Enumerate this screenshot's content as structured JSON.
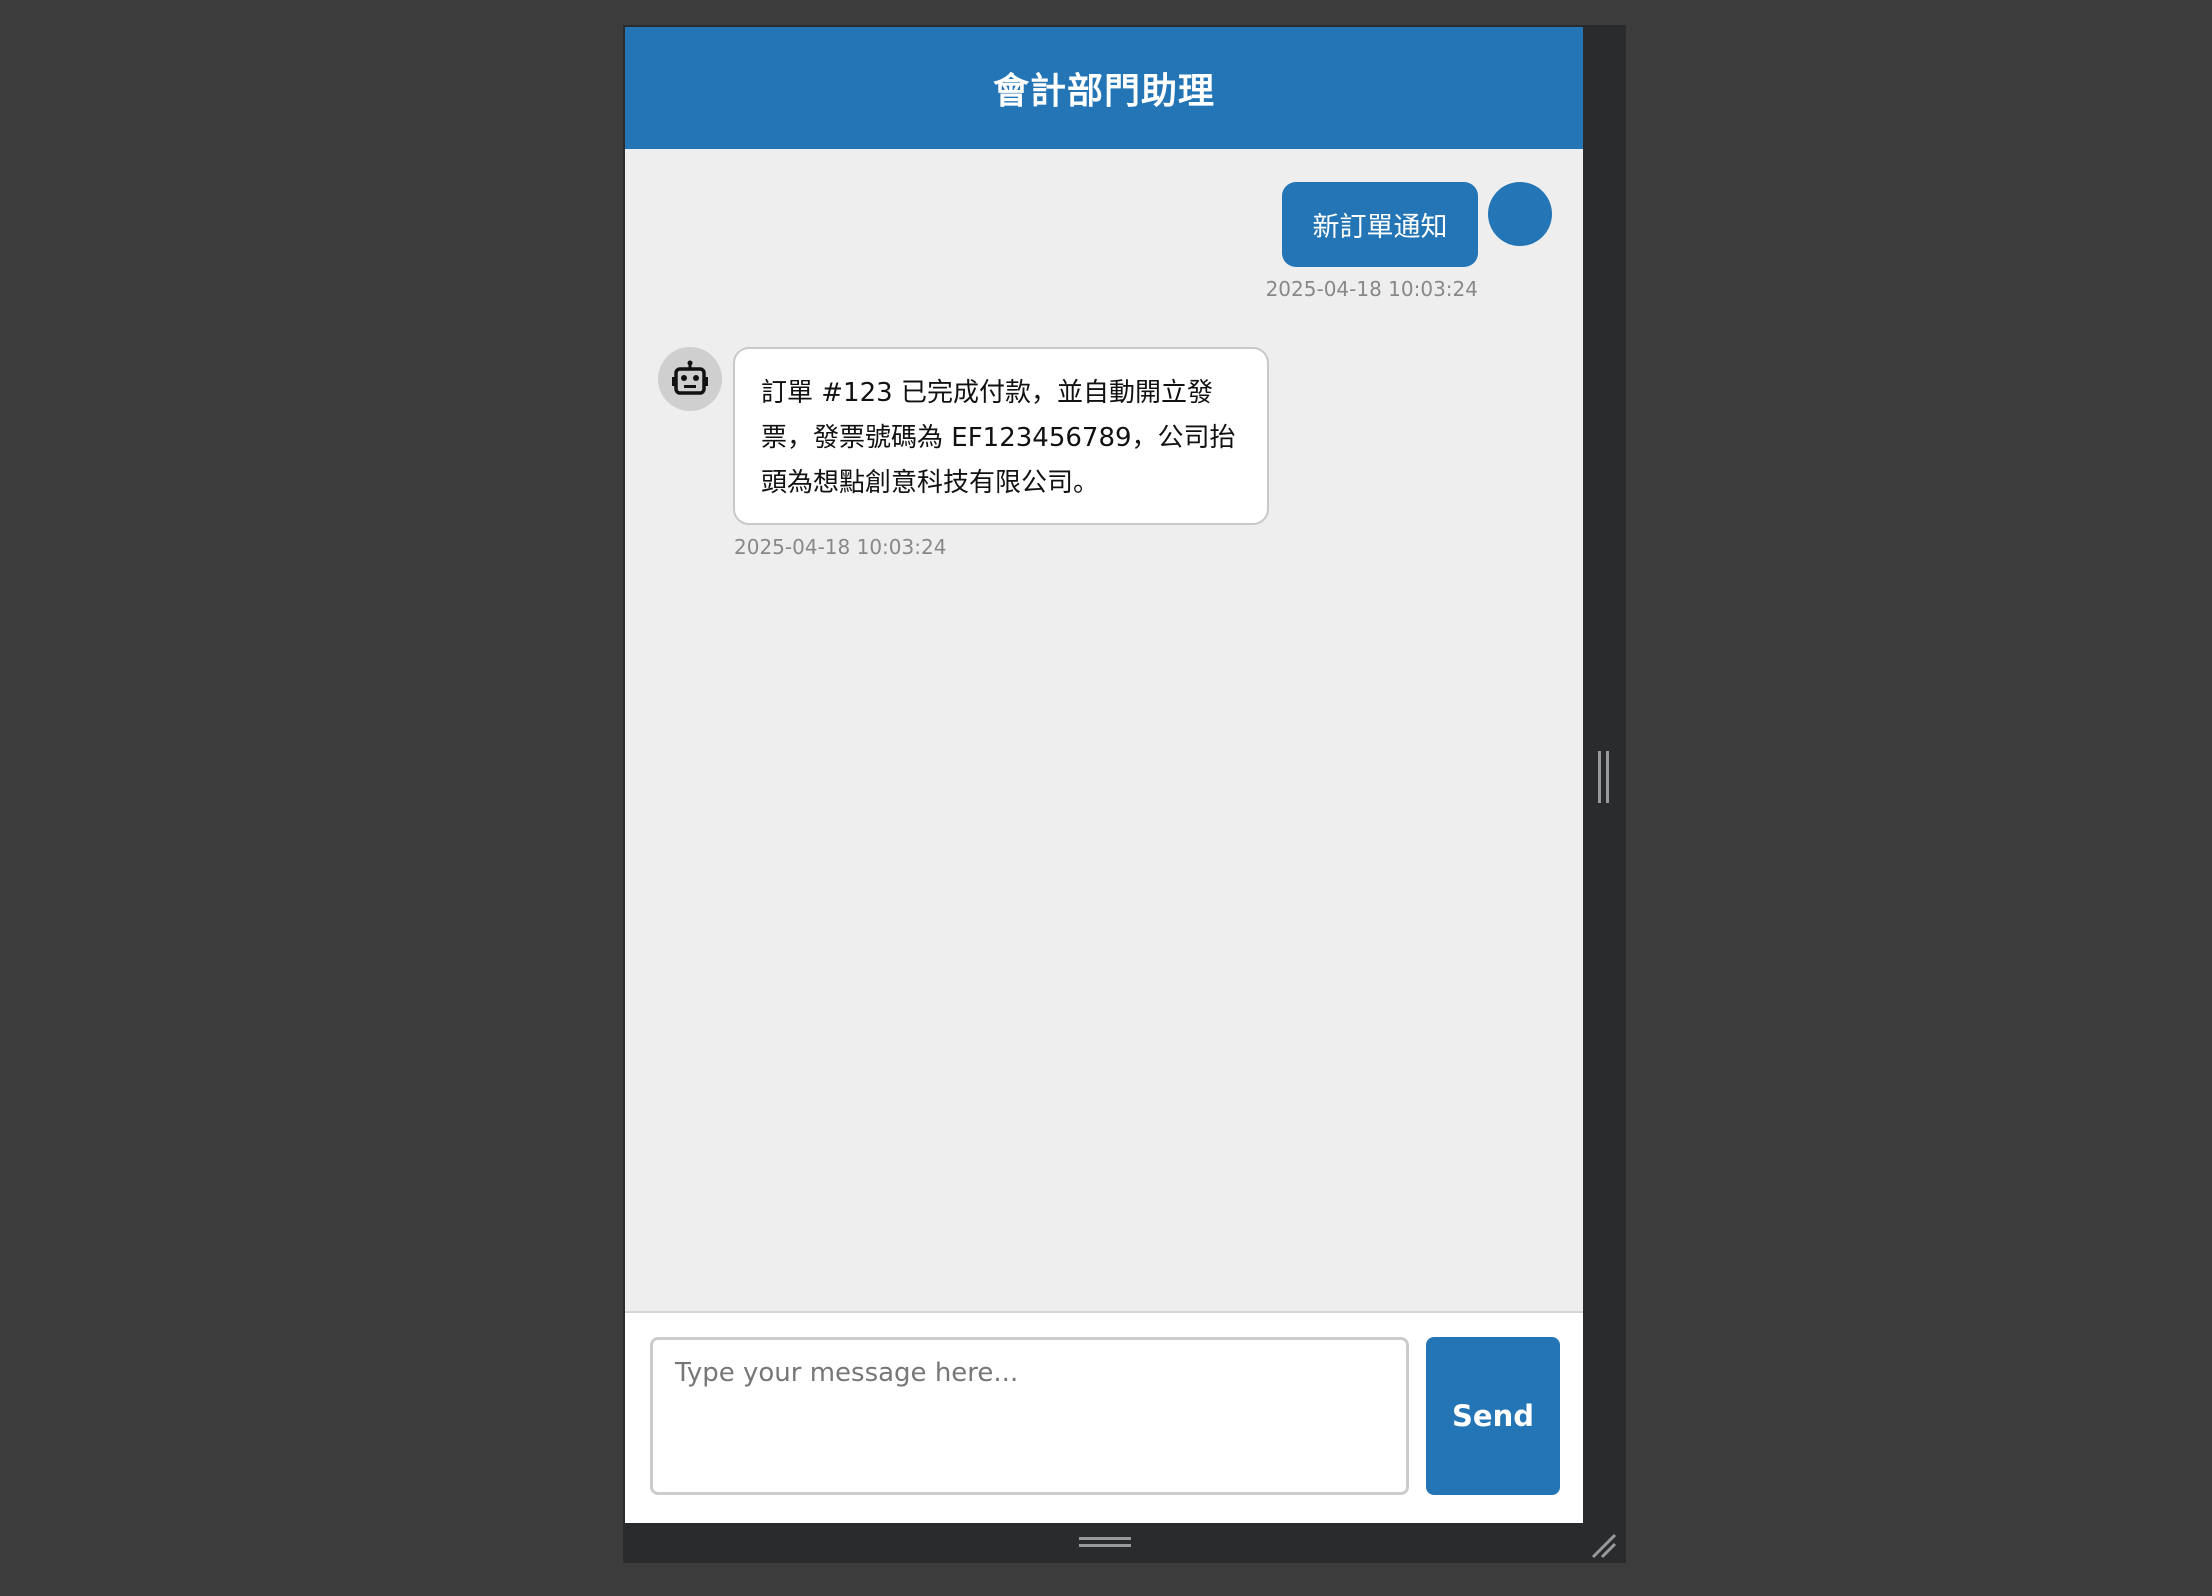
{
  "header": {
    "title": "會計部門助理"
  },
  "messages": {
    "user": {
      "text": "新訂單通知",
      "timestamp": "2025-04-18 10:03:24"
    },
    "bot": {
      "text": "訂單 #123 已完成付款，並自動開立發票，發票號碼為 EF123456789，公司抬頭為想點創意科技有限公司。",
      "timestamp": "2025-04-18 10:03:24",
      "avatar_icon": "robot-icon"
    }
  },
  "composer": {
    "placeholder": "Type your message here...",
    "value": "",
    "send_label": "Send"
  },
  "colors": {
    "accent": "#2475b5",
    "background": "#3c3c3c",
    "chat_background": "#eeeeee"
  }
}
